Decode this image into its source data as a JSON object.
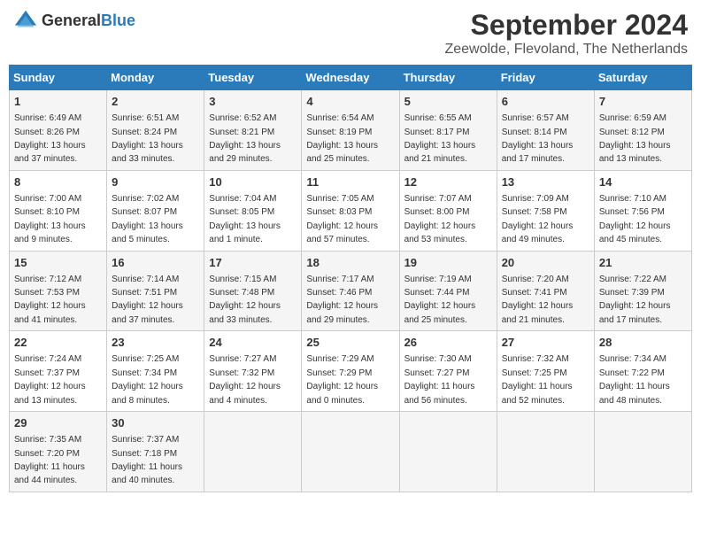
{
  "header": {
    "logo_general": "General",
    "logo_blue": "Blue",
    "title": "September 2024",
    "subtitle": "Zeewolde, Flevoland, The Netherlands"
  },
  "columns": [
    "Sunday",
    "Monday",
    "Tuesday",
    "Wednesday",
    "Thursday",
    "Friday",
    "Saturday"
  ],
  "weeks": [
    [
      {
        "day": "1",
        "sunrise": "6:49 AM",
        "sunset": "8:26 PM",
        "daylight": "13 hours and 37 minutes."
      },
      {
        "day": "2",
        "sunrise": "6:51 AM",
        "sunset": "8:24 PM",
        "daylight": "13 hours and 33 minutes."
      },
      {
        "day": "3",
        "sunrise": "6:52 AM",
        "sunset": "8:21 PM",
        "daylight": "13 hours and 29 minutes."
      },
      {
        "day": "4",
        "sunrise": "6:54 AM",
        "sunset": "8:19 PM",
        "daylight": "13 hours and 25 minutes."
      },
      {
        "day": "5",
        "sunrise": "6:55 AM",
        "sunset": "8:17 PM",
        "daylight": "13 hours and 21 minutes."
      },
      {
        "day": "6",
        "sunrise": "6:57 AM",
        "sunset": "8:14 PM",
        "daylight": "13 hours and 17 minutes."
      },
      {
        "day": "7",
        "sunrise": "6:59 AM",
        "sunset": "8:12 PM",
        "daylight": "13 hours and 13 minutes."
      }
    ],
    [
      {
        "day": "8",
        "sunrise": "7:00 AM",
        "sunset": "8:10 PM",
        "daylight": "13 hours and 9 minutes."
      },
      {
        "day": "9",
        "sunrise": "7:02 AM",
        "sunset": "8:07 PM",
        "daylight": "13 hours and 5 minutes."
      },
      {
        "day": "10",
        "sunrise": "7:04 AM",
        "sunset": "8:05 PM",
        "daylight": "13 hours and 1 minute."
      },
      {
        "day": "11",
        "sunrise": "7:05 AM",
        "sunset": "8:03 PM",
        "daylight": "12 hours and 57 minutes."
      },
      {
        "day": "12",
        "sunrise": "7:07 AM",
        "sunset": "8:00 PM",
        "daylight": "12 hours and 53 minutes."
      },
      {
        "day": "13",
        "sunrise": "7:09 AM",
        "sunset": "7:58 PM",
        "daylight": "12 hours and 49 minutes."
      },
      {
        "day": "14",
        "sunrise": "7:10 AM",
        "sunset": "7:56 PM",
        "daylight": "12 hours and 45 minutes."
      }
    ],
    [
      {
        "day": "15",
        "sunrise": "7:12 AM",
        "sunset": "7:53 PM",
        "daylight": "12 hours and 41 minutes."
      },
      {
        "day": "16",
        "sunrise": "7:14 AM",
        "sunset": "7:51 PM",
        "daylight": "12 hours and 37 minutes."
      },
      {
        "day": "17",
        "sunrise": "7:15 AM",
        "sunset": "7:48 PM",
        "daylight": "12 hours and 33 minutes."
      },
      {
        "day": "18",
        "sunrise": "7:17 AM",
        "sunset": "7:46 PM",
        "daylight": "12 hours and 29 minutes."
      },
      {
        "day": "19",
        "sunrise": "7:19 AM",
        "sunset": "7:44 PM",
        "daylight": "12 hours and 25 minutes."
      },
      {
        "day": "20",
        "sunrise": "7:20 AM",
        "sunset": "7:41 PM",
        "daylight": "12 hours and 21 minutes."
      },
      {
        "day": "21",
        "sunrise": "7:22 AM",
        "sunset": "7:39 PM",
        "daylight": "12 hours and 17 minutes."
      }
    ],
    [
      {
        "day": "22",
        "sunrise": "7:24 AM",
        "sunset": "7:37 PM",
        "daylight": "12 hours and 13 minutes."
      },
      {
        "day": "23",
        "sunrise": "7:25 AM",
        "sunset": "7:34 PM",
        "daylight": "12 hours and 8 minutes."
      },
      {
        "day": "24",
        "sunrise": "7:27 AM",
        "sunset": "7:32 PM",
        "daylight": "12 hours and 4 minutes."
      },
      {
        "day": "25",
        "sunrise": "7:29 AM",
        "sunset": "7:29 PM",
        "daylight": "12 hours and 0 minutes."
      },
      {
        "day": "26",
        "sunrise": "7:30 AM",
        "sunset": "7:27 PM",
        "daylight": "11 hours and 56 minutes."
      },
      {
        "day": "27",
        "sunrise": "7:32 AM",
        "sunset": "7:25 PM",
        "daylight": "11 hours and 52 minutes."
      },
      {
        "day": "28",
        "sunrise": "7:34 AM",
        "sunset": "7:22 PM",
        "daylight": "11 hours and 48 minutes."
      }
    ],
    [
      {
        "day": "29",
        "sunrise": "7:35 AM",
        "sunset": "7:20 PM",
        "daylight": "11 hours and 44 minutes."
      },
      {
        "day": "30",
        "sunrise": "7:37 AM",
        "sunset": "7:18 PM",
        "daylight": "11 hours and 40 minutes."
      },
      null,
      null,
      null,
      null,
      null
    ]
  ]
}
